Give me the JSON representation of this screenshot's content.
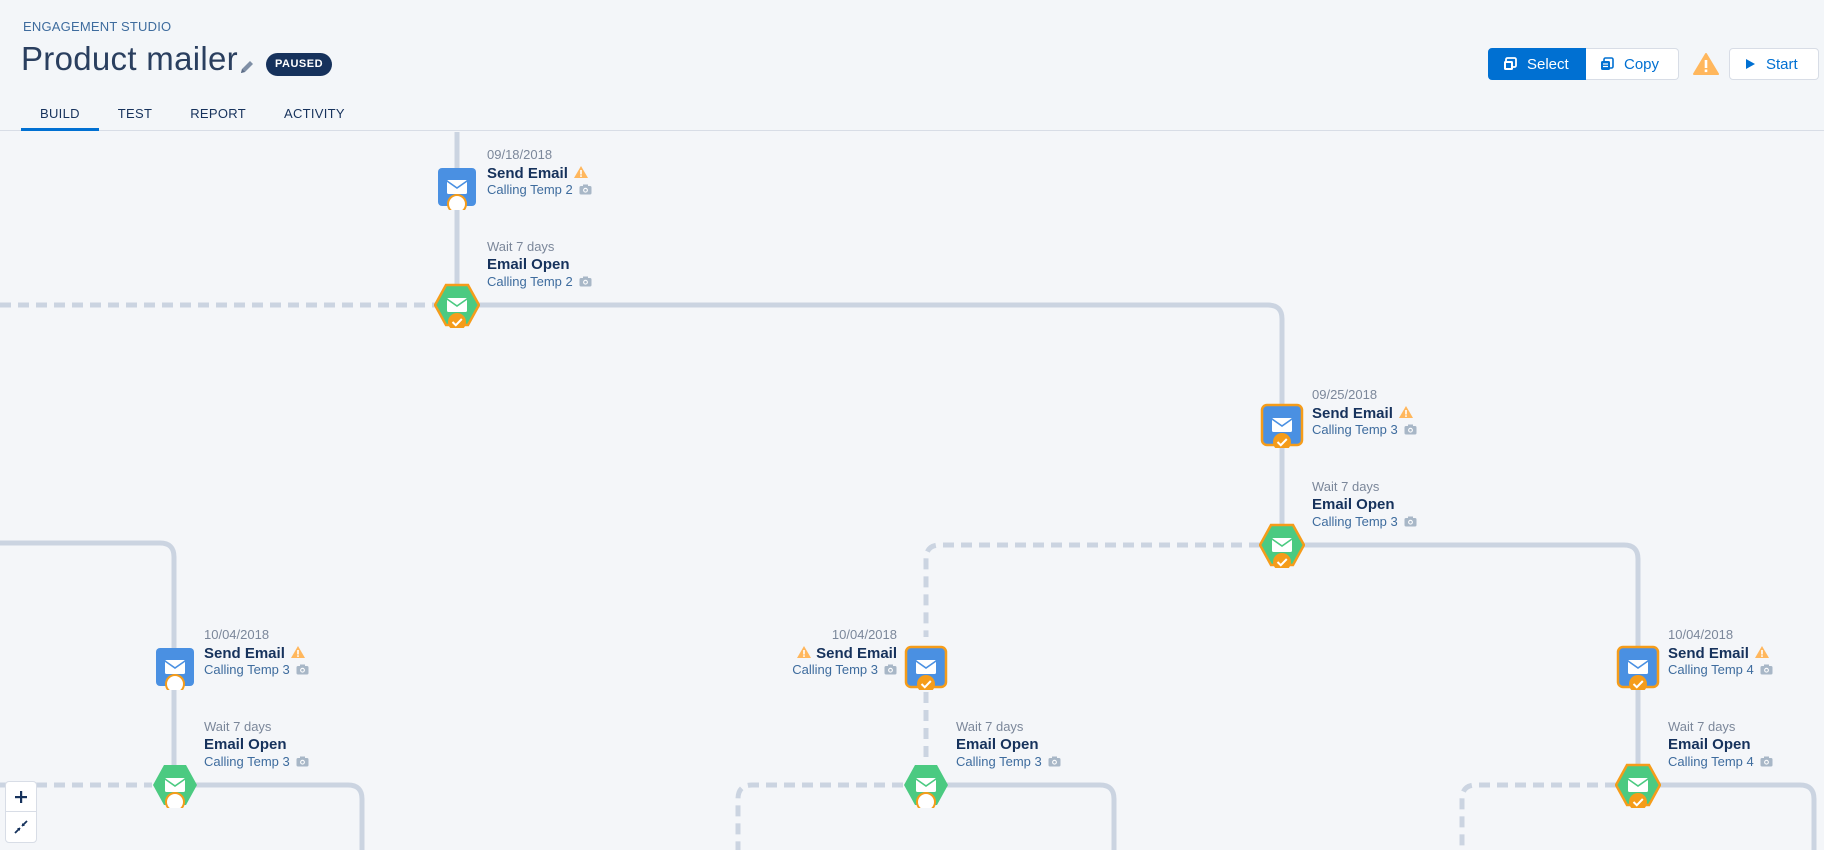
{
  "header": {
    "kicker": "ENGAGEMENT STUDIO",
    "title": "Product mailer",
    "status_badge": "PAUSED",
    "tabs": [
      "BUILD",
      "TEST",
      "REPORT",
      "ACTIVITY"
    ],
    "active_tab": "BUILD",
    "select_label": "Select",
    "copy_label": "Copy",
    "start_label": "Start"
  },
  "colors": {
    "accent": "#0070d2",
    "email_node": "#4a90e2",
    "listener_node": "#4bca81",
    "warning": "#ffb75d",
    "wire": "#c9d2df"
  },
  "nodes": [
    {
      "id": "n1",
      "date": "09/18/2018",
      "title": "Send Email",
      "sub": "Calling Temp 2",
      "warning": true
    },
    {
      "id": "n2",
      "date": "Wait 7 days",
      "title": "Email Open",
      "sub": "Calling Temp 2"
    },
    {
      "id": "n3",
      "date": "09/25/2018",
      "title": "Send Email",
      "sub": "Calling Temp 3",
      "warning": true
    },
    {
      "id": "n4",
      "date": "Wait 7 days",
      "title": "Email Open",
      "sub": "Calling Temp 3"
    },
    {
      "id": "n5",
      "date": "10/04/2018",
      "title": "Send Email",
      "sub": "Calling Temp 3",
      "warning": true
    },
    {
      "id": "n6",
      "date": "Wait 7 days",
      "title": "Email Open",
      "sub": "Calling Temp 3"
    },
    {
      "id": "n7",
      "date": "10/04/2018",
      "title": "Send Email",
      "sub": "Calling Temp 3",
      "warning": true
    },
    {
      "id": "n8",
      "date": "Wait 7 days",
      "title": "Email Open",
      "sub": "Calling Temp 3"
    },
    {
      "id": "n9",
      "date": "10/04/2018",
      "title": "Send Email",
      "sub": "Calling Temp 4",
      "warning": true
    },
    {
      "id": "n10",
      "date": "Wait 7 days",
      "title": "Email Open",
      "sub": "Calling Temp 4"
    }
  ],
  "zoom": {
    "zoom_in_icon": "plus-icon",
    "fit_icon": "collapse-icon"
  }
}
